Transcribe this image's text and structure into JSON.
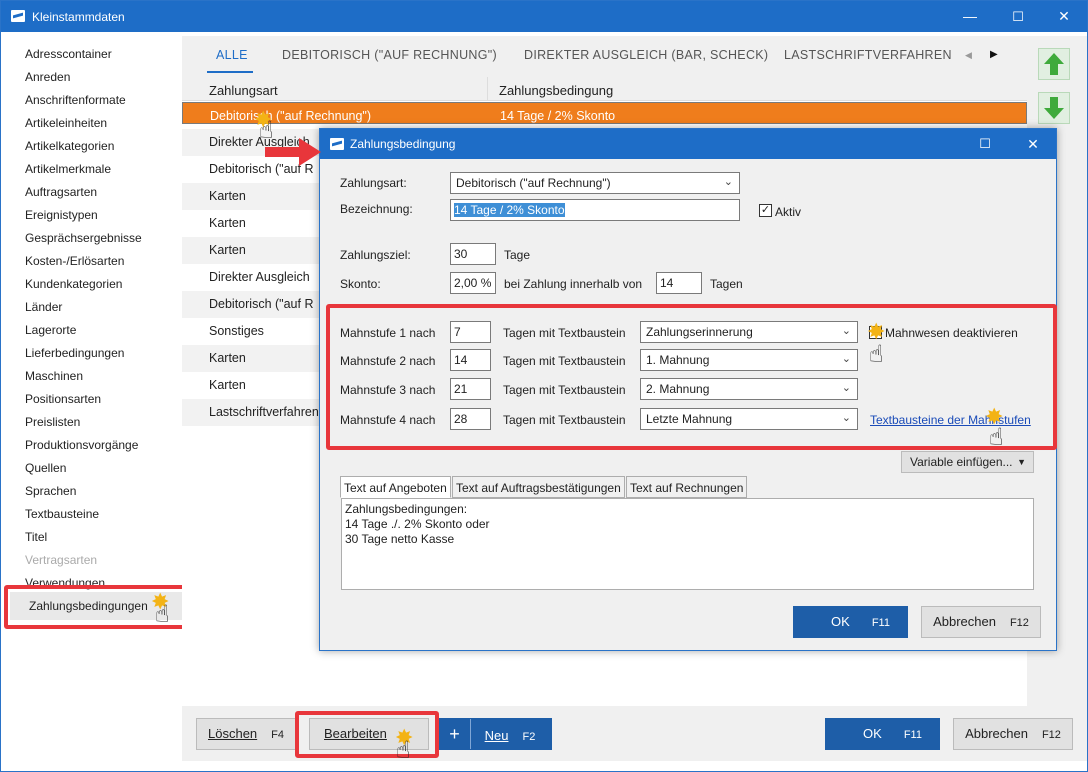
{
  "window": {
    "title": "Kleinstammdaten",
    "minimize": "—",
    "maximize": "☐",
    "close": "✕"
  },
  "sidebar": {
    "items": [
      "Adresscontainer",
      "Anreden",
      "Anschriftenformate",
      "Artikeleinheiten",
      "Artikelkategorien",
      "Artikelmerkmale",
      "Auftragsarten",
      "Ereignistypen",
      "Gesprächsergebnisse",
      "Kosten-/Erlösarten",
      "Kundenkategorien",
      "Länder",
      "Lagerorte",
      "Lieferbedingungen",
      "Maschinen",
      "Positionsarten",
      "Preislisten",
      "Produktionsvorgänge",
      "Quellen",
      "Sprachen",
      "Textbausteine",
      "Titel",
      "Vertragsarten",
      "Verwendungen",
      "Zahlungsbedingungen"
    ],
    "disabled": "Vertragsarten",
    "selected": "Zahlungsbedingungen"
  },
  "tabs": {
    "all": "ALLE",
    "debit": "DEBITORISCH (\"AUF RECHNUNG\")",
    "direct": "DIREKTER AUSGLEICH (BAR, SCHECK)",
    "lastschrift": "LASTSCHRIFTVERFAHREN",
    "prev": "◀",
    "next": "▶"
  },
  "grid": {
    "headers": {
      "c1": "Zahlungsart",
      "c2": "Zahlungsbedingung"
    },
    "rows": [
      {
        "c1": "Debitorisch (\"auf Rechnung\")",
        "c2": "14 Tage / 2% Skonto"
      },
      {
        "c1": "Direkter Ausgleich",
        "c2": ""
      },
      {
        "c1": "Debitorisch (\"auf R",
        "c2": ""
      },
      {
        "c1": "Karten",
        "c2": ""
      },
      {
        "c1": "Karten",
        "c2": ""
      },
      {
        "c1": "Karten",
        "c2": ""
      },
      {
        "c1": "Direkter Ausgleich",
        "c2": ""
      },
      {
        "c1": "Debitorisch (\"auf R",
        "c2": ""
      },
      {
        "c1": "Sonstiges",
        "c2": ""
      },
      {
        "c1": "Karten",
        "c2": ""
      },
      {
        "c1": "Karten",
        "c2": ""
      },
      {
        "c1": "Lastschriftverfahren",
        "c2": ""
      }
    ]
  },
  "bottom": {
    "delete": "Löschen",
    "delete_key": "F4",
    "edit": "Bearbeiten",
    "new_plus": "+",
    "new": "Neu",
    "new_key": "F2",
    "ok": "OK",
    "ok_key": "F11",
    "cancel": "Abbrechen",
    "cancel_key": "F12"
  },
  "dialog": {
    "title": "Zahlungsbedingung",
    "zahlungsart_label": "Zahlungsart:",
    "zahlungsart_value": "Debitorisch (\"auf Rechnung\")",
    "bezeichnung_label": "Bezeichnung:",
    "bezeichnung_value": "14 Tage / 2% Skonto",
    "aktiv_label": "Aktiv",
    "aktiv_check": "✓",
    "zahlungsziel_label": "Zahlungsziel:",
    "zahlungsziel_value": "30",
    "tage": "Tage",
    "skonto_label": "Skonto:",
    "skonto_value": "2,00 %",
    "skonto_mid": "bei Zahlung innerhalb von",
    "skonto_days": "14",
    "tagen": "Tagen",
    "mahnstufen": [
      {
        "label": "Mahnstufe 1 nach",
        "days": "7",
        "mid": "Tagen mit Textbaustein",
        "value": "Zahlungserinnerung"
      },
      {
        "label": "Mahnstufe 2 nach",
        "days": "14",
        "mid": "Tagen mit Textbaustein",
        "value": "1. Mahnung"
      },
      {
        "label": "Mahnstufe 3 nach",
        "days": "21",
        "mid": "Tagen mit Textbaustein",
        "value": "2. Mahnung"
      },
      {
        "label": "Mahnstufe 4 nach",
        "days": "28",
        "mid": "Tagen mit Textbaustein",
        "value": "Letzte Mahnung"
      }
    ],
    "mahnwesen_label": "Mahnwesen deaktivieren",
    "link": "Textbausteine der Mahnstufen",
    "variable_btn": "Variable einfügen...",
    "text_tabs": [
      "Text auf Angeboten",
      "Text auf Auftragsbestätigungen",
      "Text auf Rechnungen"
    ],
    "text_lines": [
      "Zahlungsbedingungen:",
      "14 Tage ./. 2% Skonto oder",
      "30 Tage netto Kasse"
    ],
    "ok": "OK",
    "ok_key": "F11",
    "cancel": "Abbrechen",
    "cancel_key": "F12"
  },
  "icons": {
    "chevron": "⌄",
    "arrow_up": "up-arrow-icon",
    "arrow_down": "down-arrow-icon",
    "hand": "☝"
  },
  "colors": {
    "accent": "#1e6dc7",
    "selection": "#ef7d1c",
    "highlight": "#e8363b",
    "green": "#3faa3c"
  }
}
